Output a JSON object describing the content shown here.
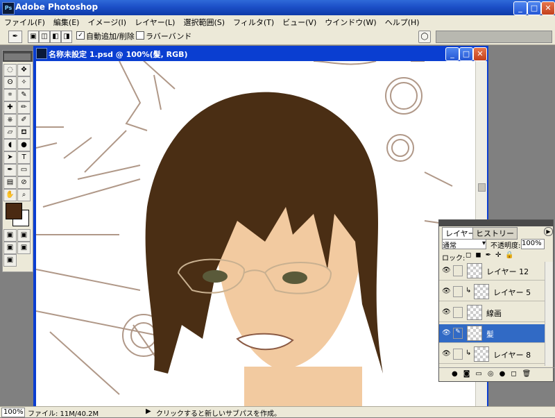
{
  "app": {
    "title": "Adobe Photoshop"
  },
  "menu": [
    "ファイル(F)",
    "編集(E)",
    "イメージ(I)",
    "レイヤー(L)",
    "選択範囲(S)",
    "フィルタ(T)",
    "ビュー(V)",
    "ウインドウ(W)",
    "ヘルプ(H)"
  ],
  "options": {
    "auto_add_delete": "自動追加/削除",
    "rubber_band": "ラバーバンド"
  },
  "document": {
    "title": "名称未設定 1.psd @ 100%(髪, RGB)"
  },
  "colors": {
    "foreground": "#4a2a12",
    "background": "#ffffff",
    "hair": "#4a2e14",
    "skin": "#f2caa0",
    "sketch": "#b09888"
  },
  "layers_panel": {
    "tabs": [
      "レイヤー",
      "ヒストリー"
    ],
    "blend_mode": "通常",
    "opacity_label": "不透明度:",
    "opacity_value": "100%",
    "lock_label": "ロック:",
    "rows": [
      {
        "name": "レイヤー 12",
        "selected": false,
        "clipped": false
      },
      {
        "name": "レイヤー 5",
        "selected": false,
        "clipped": true
      },
      {
        "name": "線画",
        "selected": false,
        "clipped": false
      },
      {
        "name": "髪",
        "selected": true,
        "clipped": false
      },
      {
        "name": "レイヤー 8",
        "selected": false,
        "clipped": true
      }
    ]
  },
  "status": {
    "zoom": "100%",
    "file_info": "ファイル: 11M/40.2M",
    "message": "クリックすると新しいサブパスを作成。"
  }
}
